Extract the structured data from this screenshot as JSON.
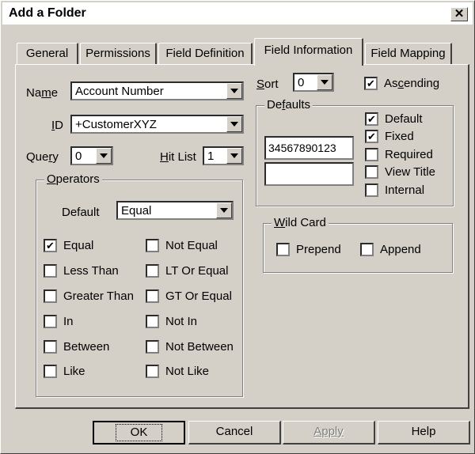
{
  "window": {
    "title": "Add a Folder"
  },
  "tabs": [
    {
      "label": "General"
    },
    {
      "label": "Permissions"
    },
    {
      "label": "Field Definition"
    },
    {
      "label": "Field Information"
    },
    {
      "label": "Field Mapping"
    }
  ],
  "fields": {
    "name": {
      "label_pre": "Na",
      "label_mn": "m",
      "label_post": "e",
      "value": "Account Number"
    },
    "id": {
      "label_pre": "",
      "label_mn": "I",
      "label_post": "D",
      "value": "+CustomerXYZ"
    },
    "query": {
      "label_pre": "Que",
      "label_mn": "r",
      "label_post": "y",
      "value": "0"
    },
    "hit_list": {
      "label_pre": "",
      "label_mn": "H",
      "label_post": "it List",
      "value": "1"
    },
    "sort": {
      "label_pre": "",
      "label_mn": "S",
      "label_post": "ort",
      "value": "0"
    },
    "ascending": {
      "label_pre": "As",
      "label_mn": "c",
      "label_post": "ending",
      "checked": "✔"
    }
  },
  "operators": {
    "title_mn": "O",
    "title_post": "perators",
    "default_label": "Default",
    "default_value": "Equal",
    "items": [
      {
        "label": "Equal",
        "checked": "✔"
      },
      {
        "label": "Not Equal",
        "checked": ""
      },
      {
        "label": "Less Than",
        "checked": ""
      },
      {
        "label": "LT Or Equal",
        "checked": ""
      },
      {
        "label": "Greater Than",
        "checked": ""
      },
      {
        "label": "GT Or Equal",
        "checked": ""
      },
      {
        "label": "In",
        "checked": ""
      },
      {
        "label": "Not In",
        "checked": ""
      },
      {
        "label": "Between",
        "checked": ""
      },
      {
        "label": "Not Between",
        "checked": ""
      },
      {
        "label": "Like",
        "checked": ""
      },
      {
        "label": "Not Like",
        "checked": ""
      }
    ]
  },
  "defaults": {
    "title_pre": "De",
    "title_mn": "f",
    "title_post": "aults",
    "value1": "34567890123",
    "value2": "",
    "options": [
      {
        "label": "Default",
        "checked": "✔"
      },
      {
        "label": "Fixed",
        "checked": "✔"
      },
      {
        "label": "Required",
        "checked": ""
      },
      {
        "label": "View Title",
        "checked": ""
      },
      {
        "label": "Internal",
        "checked": ""
      }
    ]
  },
  "wildcard": {
    "title_mn": "W",
    "title_post": "ild Card",
    "options": [
      {
        "label": "Prepend",
        "checked": ""
      },
      {
        "label": "Append",
        "checked": ""
      }
    ]
  },
  "buttons": {
    "ok": "OK",
    "cancel": "Cancel",
    "apply": "Apply",
    "help": "Help"
  }
}
